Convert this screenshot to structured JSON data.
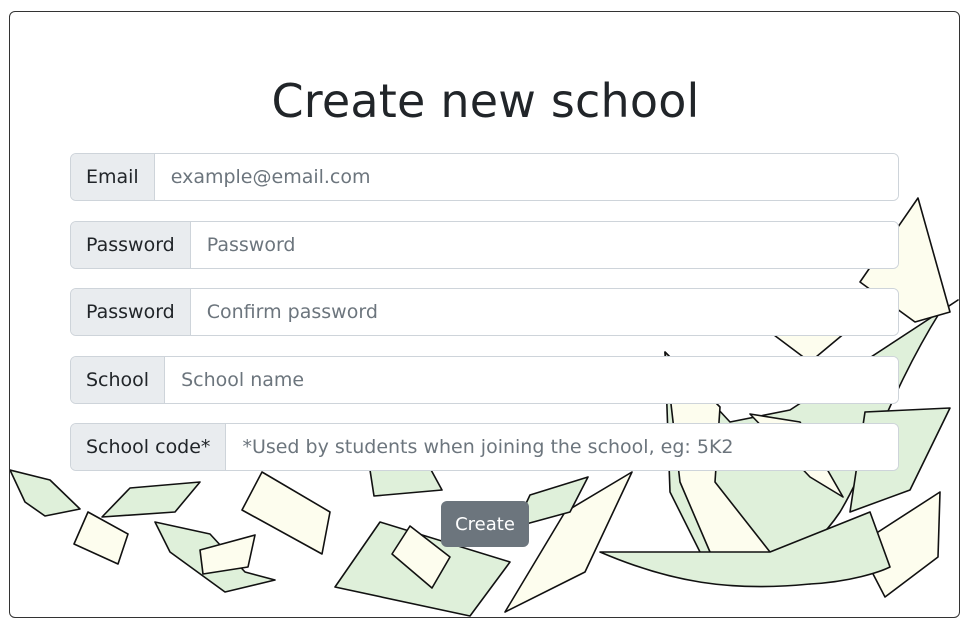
{
  "page": {
    "title": "Create new school"
  },
  "form": {
    "fields": [
      {
        "label": "Email",
        "placeholder": "example@email.com",
        "value": ""
      },
      {
        "label": "Password",
        "placeholder": "Password",
        "value": ""
      },
      {
        "label": "Password",
        "placeholder": "Confirm password",
        "value": ""
      },
      {
        "label": "School",
        "placeholder": "School name",
        "value": ""
      },
      {
        "label": "School code*",
        "placeholder": "*Used by students when joining the school, eg: 5K2",
        "value": ""
      }
    ],
    "submit_label": "Create"
  },
  "colors": {
    "paper_green": "#dff0da",
    "paper_cream": "#fdfdee",
    "button": "#6c757d",
    "addon_bg": "#e9ecef"
  }
}
